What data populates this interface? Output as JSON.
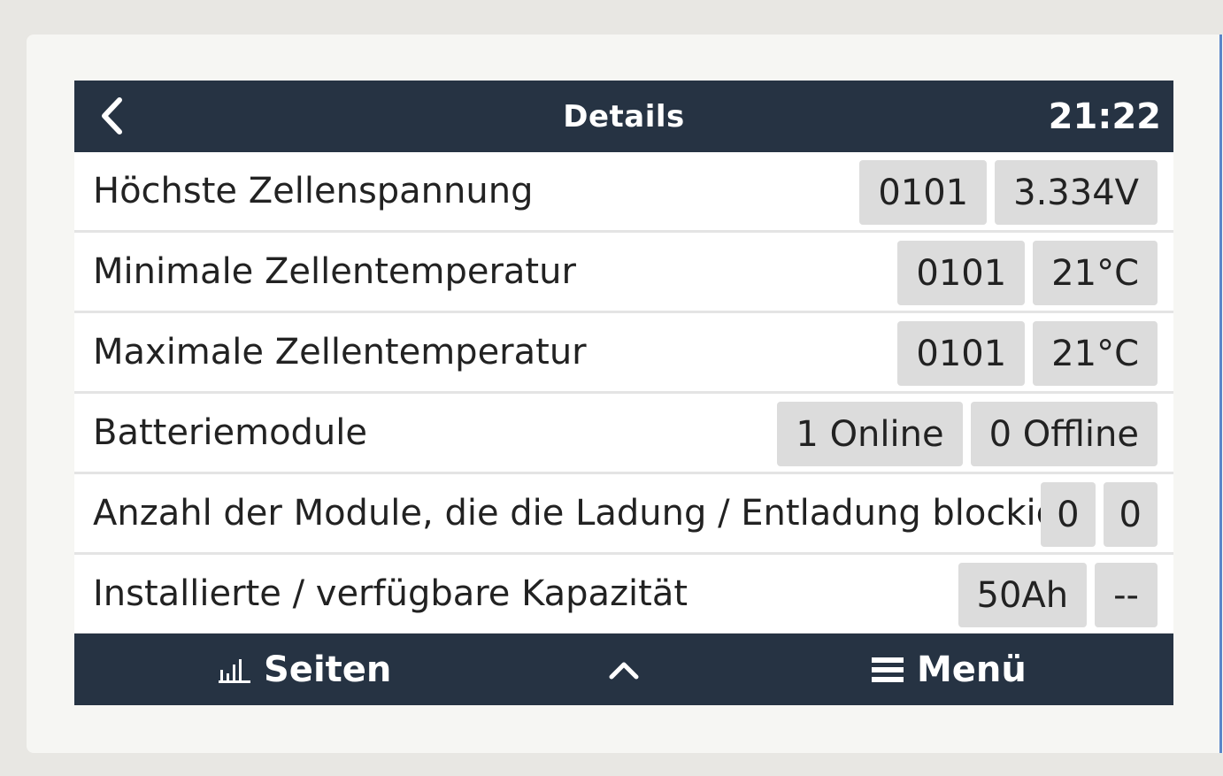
{
  "header": {
    "title": "Details",
    "clock": "21:22"
  },
  "rows": [
    {
      "label": "Höchste Zellenspannung",
      "values": [
        "0101",
        "3.334V"
      ]
    },
    {
      "label": "Minimale Zellentemperatur",
      "values": [
        "0101",
        "21°C"
      ]
    },
    {
      "label": "Maximale Zellentemperatur",
      "values": [
        "0101",
        "21°C"
      ]
    },
    {
      "label": "Batteriemodule",
      "values": [
        "1 Online",
        "0 Offline"
      ]
    },
    {
      "label": "Anzahl der Module, die die Ladung / Entladung blockieren",
      "values": [
        "0",
        "0"
      ]
    },
    {
      "label": "Installierte / verfügbare Kapazität",
      "values": [
        "50Ah",
        "--"
      ]
    }
  ],
  "footer": {
    "pages_label": "Seiten",
    "menu_label": "Menü"
  },
  "icons": {
    "back": "chevron-left-icon",
    "pages": "bar-chart-icon",
    "up": "chevron-up-icon",
    "menu": "hamburger-menu-icon"
  },
  "colors": {
    "bar_background": "#263343",
    "chip_background": "#dcdcdc",
    "page_background": "#e8e7e3"
  }
}
